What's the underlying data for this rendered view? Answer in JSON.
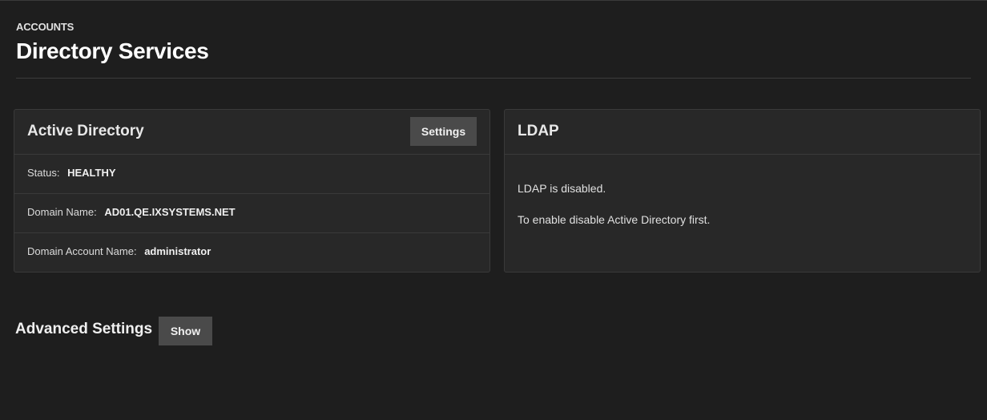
{
  "header": {
    "breadcrumb": "ACCOUNTS",
    "title": "Directory Services"
  },
  "active_directory": {
    "title": "Active Directory",
    "settings_label": "Settings",
    "rows": [
      {
        "label": "Status:",
        "value": "HEALTHY"
      },
      {
        "label": "Domain Name:",
        "value": "AD01.QE.IXSYSTEMS.NET"
      },
      {
        "label": "Domain Account Name:",
        "value": "administrator"
      }
    ]
  },
  "ldap": {
    "title": "LDAP",
    "messages": [
      "LDAP is disabled.",
      "To enable disable Active Directory first."
    ]
  },
  "advanced": {
    "title": "Advanced Settings",
    "show_label": "Show"
  },
  "colors": {
    "background": "#1e1e1e",
    "card": "#282828",
    "button": "#4a4a4a"
  }
}
